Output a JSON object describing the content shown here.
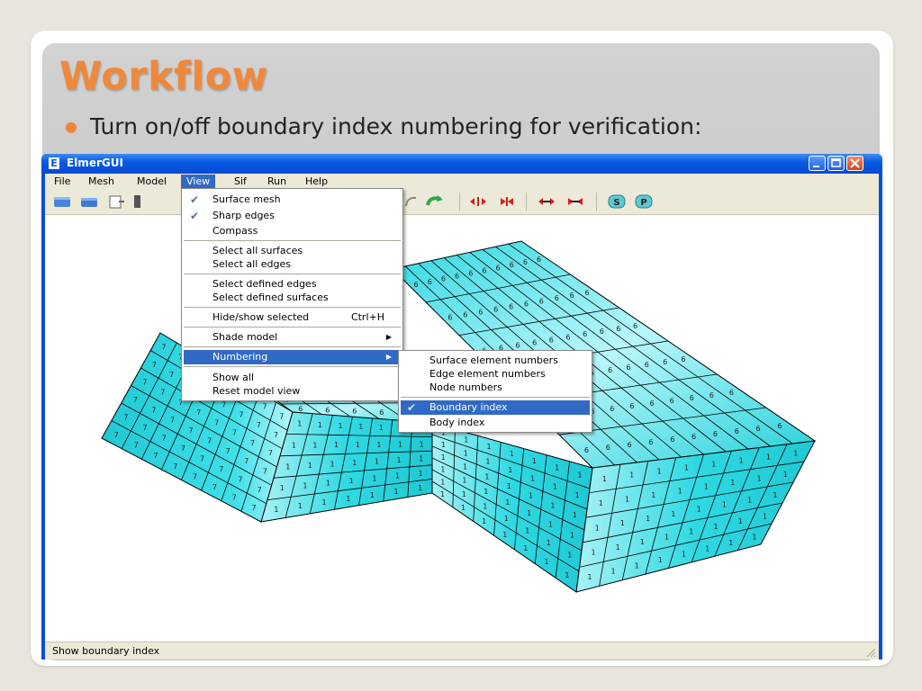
{
  "slide": {
    "title": "Workflow",
    "bullet": "Turn on/off boundary index numbering for verification:"
  },
  "window": {
    "title": "ElmerGUI",
    "icon": "elmer-app-icon",
    "controls": [
      "minimize",
      "maximize",
      "close"
    ]
  },
  "menubar": [
    "File",
    "Mesh",
    "Model",
    "View",
    "Sif",
    "Run",
    "Help"
  ],
  "active_menu": "View",
  "toolbar_icons": [
    "open-file-icon",
    "save-file-icon",
    "export-icon",
    "undo-icon",
    "redo-icon",
    "expand-horizontal-icon",
    "contract-horizontal-icon",
    "move-left-right-icon",
    "move-right-left-icon",
    "solver-S-icon",
    "parallel-P-icon"
  ],
  "view_menu": {
    "items": [
      {
        "label": "Surface mesh",
        "checked": true
      },
      {
        "label": "Sharp edges",
        "checked": true
      },
      {
        "label": "Compass"
      },
      {
        "label": "Select all surfaces"
      },
      {
        "label": "Select all edges"
      },
      {
        "label": "Select defined edges"
      },
      {
        "label": "Select defined surfaces"
      },
      {
        "label": "Hide/show selected",
        "shortcut": "Ctrl+H"
      },
      {
        "label": "Shade model",
        "submenu": true
      },
      {
        "label": "Numbering",
        "submenu": true,
        "highlighted": true
      },
      {
        "label": "Show all"
      },
      {
        "label": "Reset model view"
      }
    ]
  },
  "numbering_menu": {
    "items": [
      {
        "label": "Surface element numbers"
      },
      {
        "label": "Edge element numbers"
      },
      {
        "label": "Node numbers"
      },
      {
        "label": "Boundary index",
        "checked": true,
        "highlighted": true
      },
      {
        "label": "Body index"
      }
    ]
  },
  "mesh_labels": {
    "top": "6",
    "front": "1",
    "left": "7"
  },
  "colors": {
    "accent": "#f0883a",
    "mesh_face": "#33e0e8",
    "mesh_face_light": "#b8f7fb",
    "menu_highlight": "#316ac5",
    "titlebar": "#0a5be3"
  },
  "status": "Show boundary index"
}
